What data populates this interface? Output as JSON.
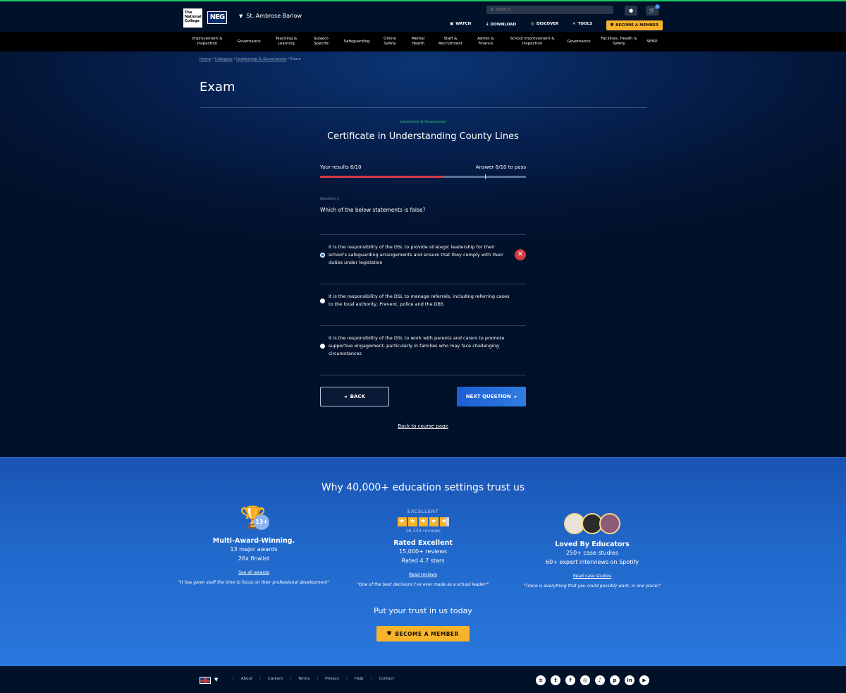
{
  "header": {
    "logo_tnc": "The National College",
    "logo_neg": "NEG",
    "school": "St. Ambrose Barlow",
    "search_placeholder": "SEARCH...",
    "cart_count": "0",
    "watch": "WATCH",
    "download": "DOWNLOAD",
    "discover": "DISCOVER",
    "tools": "TOOLS",
    "become_member": "BECOME A MEMBER"
  },
  "nav": [
    "Improvement & Inspection",
    "Governance",
    "Teaching & Learning",
    "Subject-Specific",
    "Safeguarding",
    "Online Safety",
    "Mental Health",
    "Staff & Recruitment",
    "Admin & Finance",
    "School Improvement & Inspection",
    "Governance",
    "Facilities, Health & Safety",
    "SEND"
  ],
  "breadcrumb": {
    "home": "Home",
    "category": "Category",
    "section": "Leadership & Governance",
    "current": "Exam"
  },
  "page_title": "Exam",
  "exam": {
    "category": "Leadership & Governance",
    "course_title": "Certificate in Understanding County Lines",
    "results_label": "Your results 6/10",
    "pass_label": "Answer 8/10 to pass",
    "score": 6,
    "pass_mark": 8,
    "total": 10,
    "question_label": "Question 1",
    "question": "Which of the below statements is false?",
    "answers": [
      {
        "text": "It is the responsibility of the DSL to provide strategic leadership for their school's safeguarding arrangements and ensure that they comply with their duties under legislation",
        "selected": true,
        "wrong": true
      },
      {
        "text": "It is the responsibility of the DSL to manage referrals, including referring cases to the local authority, Prevent, police and the DBS",
        "selected": false,
        "wrong": false
      },
      {
        "text": "It is the responsibility of the DSL to work with parents and carers to promote supportive engagement, particularly in families who may face challenging circumstances",
        "selected": false,
        "wrong": false
      }
    ],
    "back": "BACK",
    "next": "NEXT QUESTION",
    "back_link": "Back to course page"
  },
  "trust": {
    "title": "Why 40,000+ education settings trust us",
    "awards": {
      "count": "13+",
      "head": "Multi-Award-Winning.",
      "line1": "13 major awards",
      "line2": "26x finalist",
      "link": "See all awards",
      "quote": "\"It has given staff the time to focus on their professional development\""
    },
    "rated": {
      "excellent": "EXCELLENT",
      "reviews_small": "16,134 reviews",
      "rating": 4.7,
      "head": "Rated Excellent",
      "line1": "15,000+ reviews",
      "line2": "Rated 4.7 stars",
      "link": "Read reviews",
      "quote": "\"One of the best decisions I've ever made as a school leader!\""
    },
    "loved": {
      "head": "Loved By Educators",
      "line1": "250+ case studies",
      "line2": "60+ expert interviews on Spotify",
      "link": "Read case studies",
      "quote": "\"There is everything that you could possibly want, in one place!\""
    },
    "cta": "Put your trust in us today",
    "become_member": "BECOME A MEMBER"
  },
  "footer": {
    "links": [
      "About",
      "Careers",
      "Terms",
      "Privacy",
      "Help",
      "Contact"
    ],
    "socials": [
      "spotify-icon",
      "twitter-icon",
      "facebook-icon",
      "instagram-icon",
      "tiktok-icon",
      "pinterest-icon",
      "linkedin-icon",
      "youtube-icon"
    ]
  },
  "colors": {
    "accent_blue": "#2e7de1",
    "gold": "#f6b32b",
    "wrong_red": "#d03b43",
    "category_green": "#27c46b"
  }
}
